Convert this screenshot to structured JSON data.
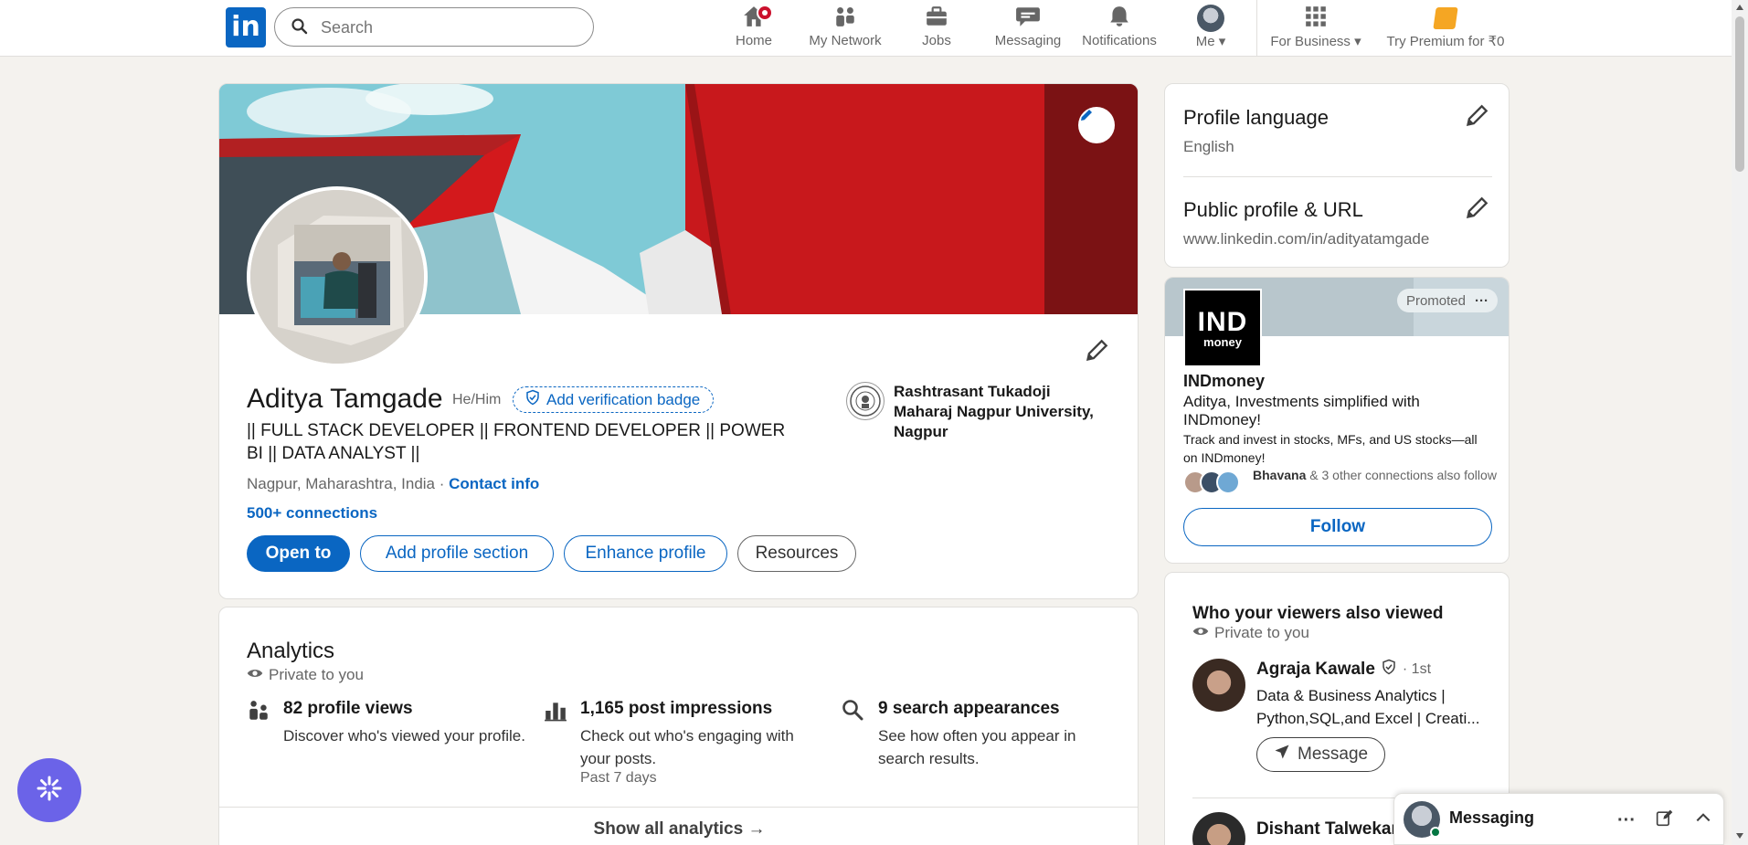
{
  "nav": {
    "logo_text": "in",
    "search_placeholder": "Search",
    "items": [
      {
        "label": "Home",
        "icon": "home-icon"
      },
      {
        "label": "My Network",
        "icon": "network-icon"
      },
      {
        "label": "Jobs",
        "icon": "briefcase-icon"
      },
      {
        "label": "Messaging",
        "icon": "chat-icon"
      },
      {
        "label": "Notifications",
        "icon": "bell-icon"
      },
      {
        "label": "Me",
        "icon": "avatar"
      }
    ],
    "business_label": "For Business",
    "premium_label": "Try Premium for ₹0"
  },
  "profile": {
    "name": "Aditya Tamgade",
    "pronouns": "He/Him",
    "verification_label": "Add verification badge",
    "headline": "|| FULL STACK DEVELOPER || FRONTEND DEVELOPER || POWER BI || DATA ANALYST ||",
    "location": "Nagpur, Maharashtra, India",
    "location_sep": " · ",
    "contact_label": "Contact info",
    "connections": "500+ connections",
    "education": "Rashtrasant Tukadoji Maharaj Nagpur University, Nagpur",
    "buttons": {
      "open_to": "Open to",
      "add_section": "Add profile section",
      "enhance": "Enhance profile",
      "resources": "Resources"
    }
  },
  "analytics": {
    "title": "Analytics",
    "private_label": "Private to you",
    "stats": [
      {
        "title": "82 profile views",
        "desc": "Discover who's viewed your profile.",
        "extra": ""
      },
      {
        "title": "1,165 post impressions",
        "desc": "Check out who's engaging with your posts.",
        "extra": "Past 7 days"
      },
      {
        "title": "9 search appearances",
        "desc": "See how often you appear in search results.",
        "extra": ""
      }
    ],
    "show_all": "Show all analytics →"
  },
  "sidebar": {
    "language_title": "Profile language",
    "language_value": "English",
    "public_title": "Public profile & URL",
    "public_url": "www.linkedin.com/in/adityatamgade"
  },
  "ad": {
    "promoted_label": "Promoted",
    "more": "···",
    "logo_big": "IND",
    "logo_small": "money",
    "company": "INDmoney",
    "tagline": "Aditya, Investments simplified with INDmoney!",
    "description": "Track and invest in stocks, MFs, and US stocks—all on INDmoney!",
    "follower_name": "Bhavana",
    "follower_rest": " & 3 other connections also follow",
    "follow_label": "Follow"
  },
  "viewers": {
    "title": "Who your viewers also viewed",
    "private_label": "Private to you",
    "people": [
      {
        "name": "Agraja Kawale",
        "degree": "· 1st",
        "headline": "Data & Business Analytics | Python,SQL,and Excel | Creati..."
      },
      {
        "name": "Dishant Talwekar",
        "degree": "",
        "headline": ""
      }
    ],
    "message_label": "Message"
  },
  "dock": {
    "title": "Messaging"
  },
  "colors": {
    "brand": "#0a66c2",
    "background": "#f4f2ee",
    "notification": "#cb112d",
    "launcher": "#6b63e8"
  }
}
